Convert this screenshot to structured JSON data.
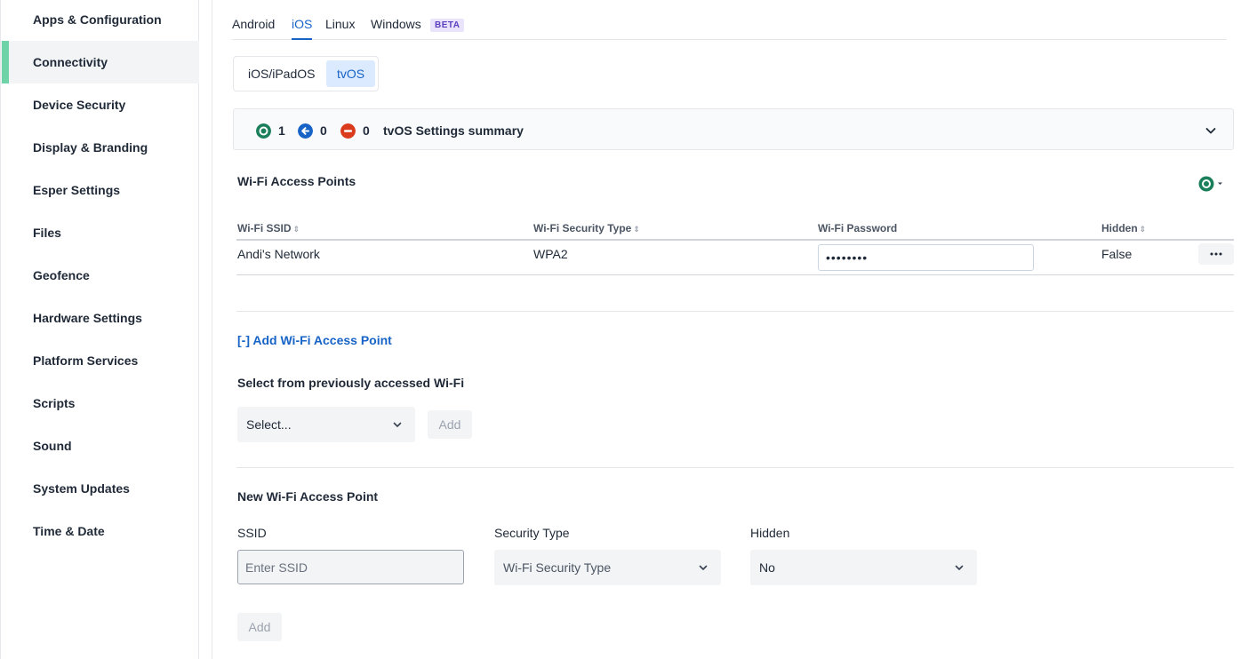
{
  "sidebar": {
    "items": [
      {
        "label": "Apps & Configuration"
      },
      {
        "label": "Connectivity"
      },
      {
        "label": "Device Security"
      },
      {
        "label": "Display & Branding"
      },
      {
        "label": "Esper Settings"
      },
      {
        "label": "Files"
      },
      {
        "label": "Geofence"
      },
      {
        "label": "Hardware Settings"
      },
      {
        "label": "Platform Services"
      },
      {
        "label": "Scripts"
      },
      {
        "label": "Sound"
      },
      {
        "label": "System Updates"
      },
      {
        "label": "Time & Date"
      }
    ],
    "active": "Connectivity"
  },
  "platform_tabs": {
    "android": "Android",
    "ios": "iOS",
    "linux": "Linux",
    "windows": "Windows",
    "windows_badge": "BETA",
    "active": "iOS"
  },
  "os_segment": {
    "ios_ipados": "iOS/iPadOS",
    "tvos": "tvOS",
    "active": "tvOS"
  },
  "summary": {
    "enabled_count": "1",
    "inherited_count": "0",
    "disabled_count": "0",
    "title": "tvOS Settings summary",
    "colors": {
      "enabled": "#1a7f5a",
      "inherited": "#1763c6",
      "disabled": "#d93b1c"
    }
  },
  "wifi": {
    "section_title": "Wi-Fi Access Points",
    "columns": {
      "ssid": "Wi-Fi SSID",
      "security": "Wi-Fi Security Type",
      "password": "Wi-Fi Password",
      "hidden": "Hidden"
    },
    "rows": [
      {
        "ssid": "Andi's Network",
        "security": "WPA2",
        "password": "••••••••",
        "hidden": "False"
      }
    ],
    "add_link": "[-] Add Wi-Fi Access Point",
    "previous_label": "Select from previously accessed Wi-Fi",
    "previous_select": "Select...",
    "previous_add": "Add",
    "new_title": "New Wi-Fi Access Point",
    "ssid_label": "SSID",
    "ssid_placeholder": "Enter SSID",
    "security_label": "Security Type",
    "security_select": "Wi-Fi Security Type",
    "hidden_label": "Hidden",
    "hidden_select": "No",
    "new_add": "Add"
  }
}
